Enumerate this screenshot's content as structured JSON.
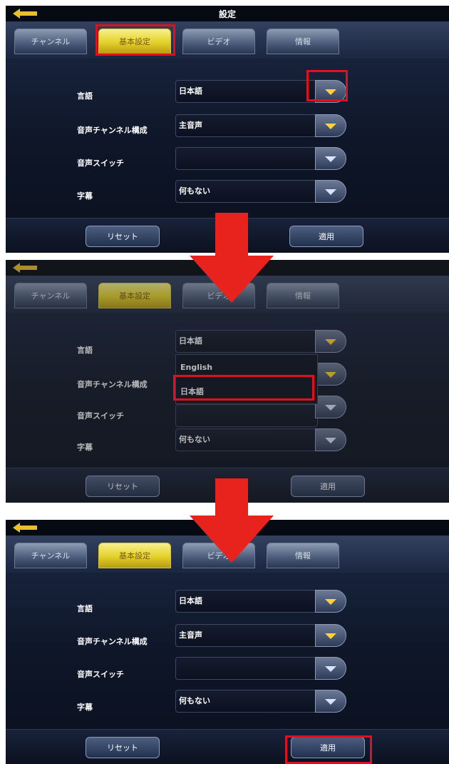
{
  "app_title": "設定",
  "tabs": [
    {
      "label": "チャンネル"
    },
    {
      "label": "基本設定"
    },
    {
      "label": "ビデオ"
    },
    {
      "label": "情報"
    }
  ],
  "settings": {
    "language_label": "言語",
    "language_value": "日本語",
    "audio_channel_label": "音声チャンネル構成",
    "audio_channel_value": "主音声",
    "audio_switch_label": "音声スイッチ",
    "audio_switch_value": "",
    "subtitle_label": "字幕",
    "subtitle_value": "何もない"
  },
  "dropdown_options": [
    "English",
    "日本語"
  ],
  "buttons": {
    "reset_label": "リセット",
    "apply_label": "適用"
  },
  "colors": {
    "highlight": "#e0101e",
    "arrow": "#e8231d",
    "active_tab": "#e3d12a"
  }
}
